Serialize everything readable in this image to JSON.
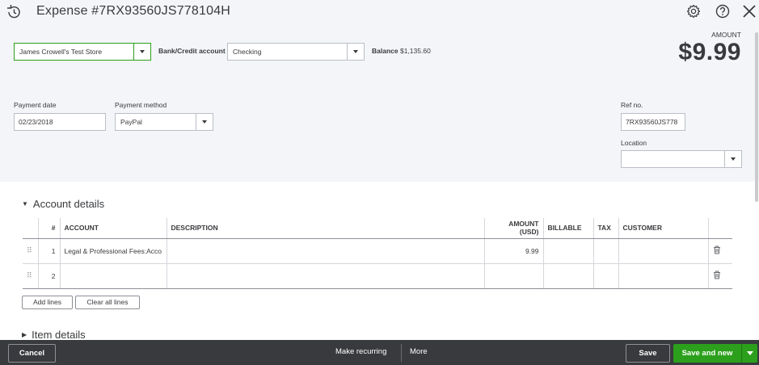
{
  "header": {
    "title": "Expense #7RX93560JS778104H",
    "icons": [
      "history-icon",
      "gear-icon",
      "help-icon",
      "close-icon"
    ]
  },
  "amount": {
    "label": "AMOUNT",
    "value": "$9.99"
  },
  "payee": {
    "value": "James Crowell's Test Store"
  },
  "bank_account": {
    "label": "Bank/Credit account",
    "value": "Checking"
  },
  "balance": {
    "label": "Balance",
    "value": "$1,135.60"
  },
  "payment_date": {
    "label": "Payment date",
    "value": "02/23/2018"
  },
  "payment_method": {
    "label": "Payment method",
    "value": "PayPal"
  },
  "ref_no": {
    "label": "Ref no.",
    "value": "7RX93560JS778"
  },
  "location": {
    "label": "Location",
    "value": ""
  },
  "account_details": {
    "heading": "Account details",
    "columns": [
      "#",
      "ACCOUNT",
      "DESCRIPTION",
      "AMOUNT (USD)",
      "BILLABLE",
      "TAX",
      "CUSTOMER"
    ],
    "rows": [
      {
        "num": "1",
        "account": "Legal & Professional Fees:Acco",
        "description": "",
        "amount": "9.99",
        "billable": "",
        "tax": "",
        "customer": ""
      },
      {
        "num": "2",
        "account": "",
        "description": "",
        "amount": "",
        "billable": "",
        "tax": "",
        "customer": ""
      }
    ],
    "add_lines": "Add lines",
    "clear_all_lines": "Clear all lines"
  },
  "item_details": {
    "heading": "Item details"
  },
  "footer": {
    "cancel": "Cancel",
    "make_recurring": "Make recurring",
    "more": "More",
    "save": "Save",
    "save_and_new": "Save and new"
  },
  "colors": {
    "accent_green": "#2ca01c",
    "footer_bg": "#393a3d",
    "top_bg": "#f4f5f8"
  }
}
